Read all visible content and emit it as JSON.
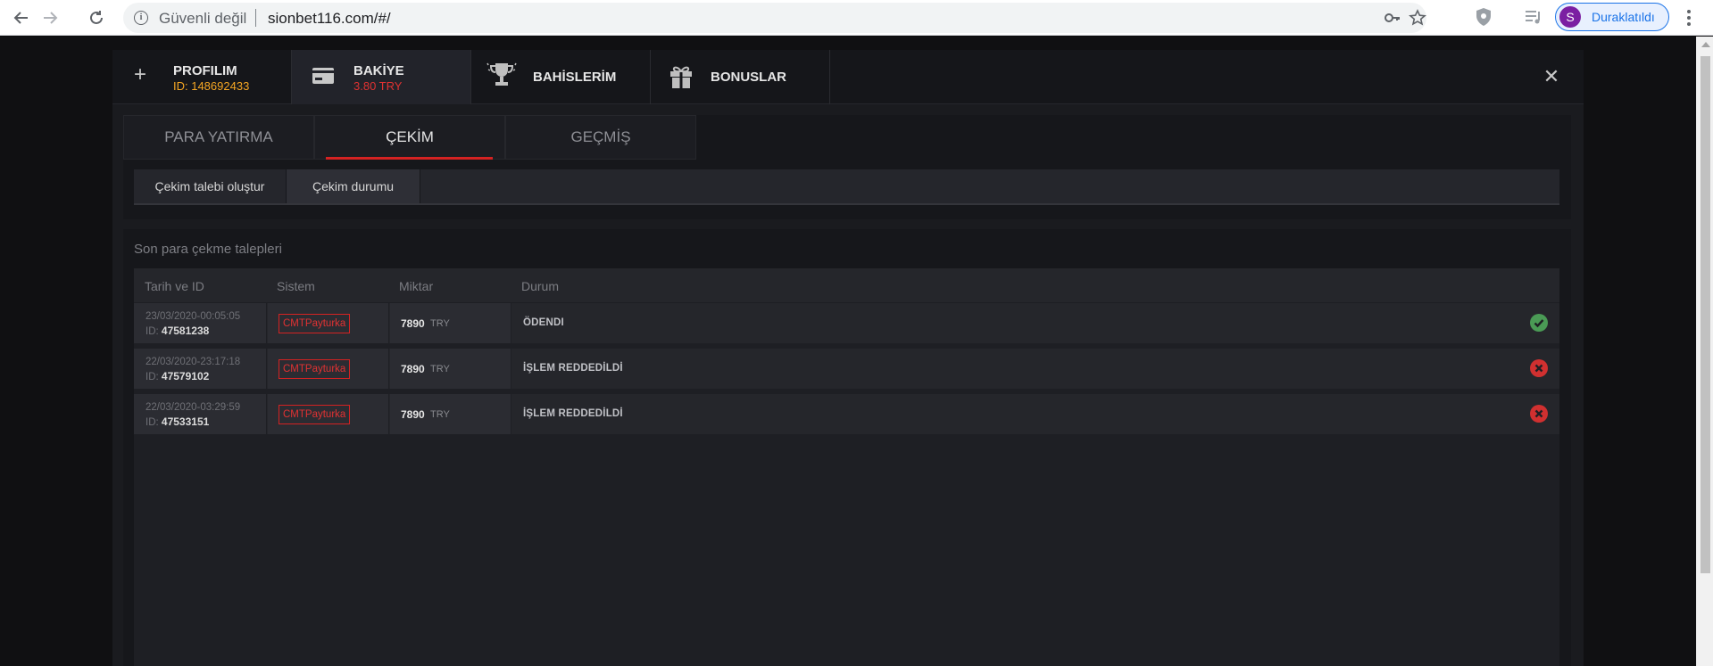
{
  "browser": {
    "security_label": "Güvenli değil",
    "url": "sionbet116.com/#/",
    "profile_initial": "S",
    "profile_label": "Duraklatıldı"
  },
  "header": {
    "tabs": [
      {
        "title": "PROFILIM",
        "subtitle": "ID: 148692433",
        "subtitle_color": "#f5a623"
      },
      {
        "title": "BAKİYE",
        "subtitle": "3.80 TRY",
        "subtitle_color": "#e03232"
      },
      {
        "title": "BAHİSLERİM"
      },
      {
        "title": "BONUSLAR"
      }
    ]
  },
  "main_tabs": [
    "PARA YATIRMA",
    "ÇEKİM",
    "GEÇMİŞ"
  ],
  "sub_tabs": [
    "Çekim talebi oluştur",
    "Çekim durumu"
  ],
  "section_title": "Son para çekme talepleri",
  "table": {
    "headers": [
      "Tarih ve ID",
      "Sistem",
      "Miktar",
      "Durum"
    ],
    "id_prefix": "ID:",
    "rows": [
      {
        "date": "23/03/2020-00:05:05",
        "id": "47581238",
        "system": "CMTPayturka",
        "amount": "7890",
        "currency": "TRY",
        "status": "ÖDENDI",
        "status_type": "ok"
      },
      {
        "date": "22/03/2020-23:17:18",
        "id": "47579102",
        "system": "CMTPayturka",
        "amount": "7890",
        "currency": "TRY",
        "status": "İŞLEM REDDEDİLDİ",
        "status_type": "err"
      },
      {
        "date": "22/03/2020-03:29:59",
        "id": "47533151",
        "system": "CMTPayturka",
        "amount": "7890",
        "currency": "TRY",
        "status": "İŞLEM REDDEDİLDİ",
        "status_type": "err"
      }
    ]
  },
  "icons": {
    "back": "arrow-left-icon",
    "forward": "arrow-right-icon",
    "reload": "reload-icon",
    "close": "close-icon"
  }
}
